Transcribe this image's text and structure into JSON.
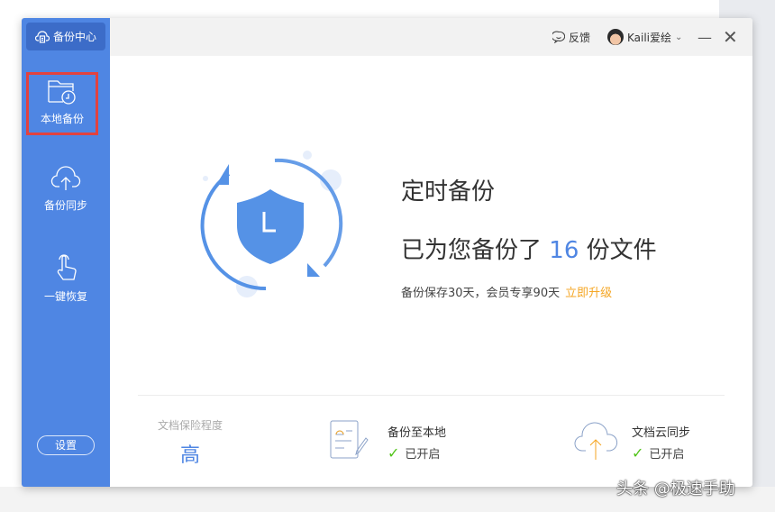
{
  "sidebar": {
    "brand": "备份中心",
    "items": [
      {
        "label": "本地备份",
        "icon": "folder-clock-icon"
      },
      {
        "label": "备份同步",
        "icon": "cloud-upload-icon"
      },
      {
        "label": "一键恢复",
        "icon": "hand-pointer-icon"
      }
    ],
    "settings": "设置"
  },
  "topbar": {
    "feedback": "反馈",
    "username": "Kaili爱绘"
  },
  "main": {
    "title": "定时备份",
    "summary_prefix": "已为您备份了",
    "count": "16",
    "summary_suffix": "份文件",
    "note": "备份保存30天，会员专享90天",
    "upgrade": "立即升级"
  },
  "footer": {
    "level_label": "文档保险程度",
    "level": "高",
    "features": [
      {
        "title": "备份至本地",
        "status": "已开启"
      },
      {
        "title": "文档云同步",
        "status": "已开启"
      }
    ]
  },
  "watermark": "头条 @极速手助",
  "colors": {
    "accent": "#4f86e3",
    "highlight": "#e2423f",
    "upgrade": "#f5a623",
    "check": "#52c41a"
  }
}
